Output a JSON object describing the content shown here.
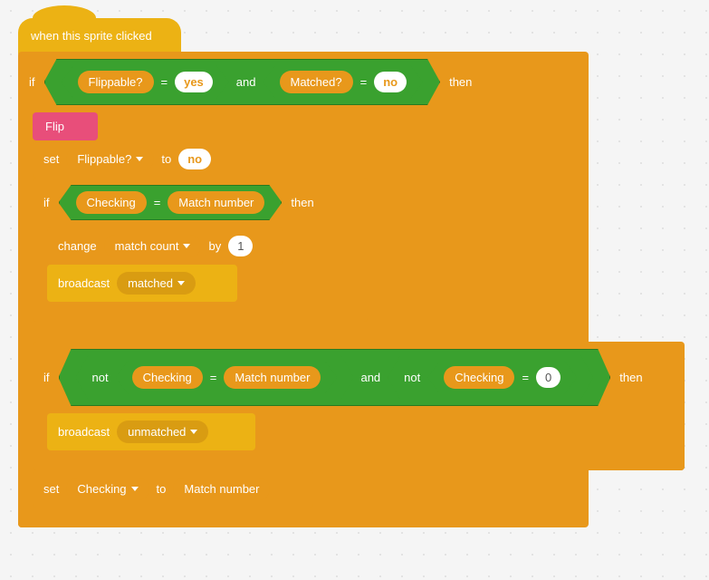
{
  "hat": {
    "label": "when this sprite clicked"
  },
  "if1": {
    "keyword_if": "if",
    "keyword_then": "then",
    "cond": {
      "left": {
        "var": "Flippable?",
        "eq": "=",
        "val": "yes"
      },
      "and": "and",
      "right": {
        "var": "Matched?",
        "eq": "=",
        "val": "no"
      }
    }
  },
  "flip": {
    "label": "Flip"
  },
  "set1": {
    "set": "set",
    "var": "Flippable?",
    "to": "to",
    "val": "no"
  },
  "if2": {
    "keyword_if": "if",
    "keyword_then": "then",
    "cond": {
      "left": "Checking",
      "eq": "=",
      "right": "Match number"
    }
  },
  "change": {
    "change": "change",
    "var": "match count",
    "by": "by",
    "val": "1"
  },
  "bc1": {
    "broadcast": "broadcast",
    "msg": "matched"
  },
  "if3": {
    "keyword_if": "if",
    "keyword_then": "then",
    "and": "and",
    "not": "not",
    "condL": {
      "left": "Checking",
      "eq": "=",
      "right": "Match number"
    },
    "condR": {
      "left": "Checking",
      "eq": "=",
      "right": "0"
    }
  },
  "bc2": {
    "broadcast": "broadcast",
    "msg": "unmatched"
  },
  "set2": {
    "set": "set",
    "var": "Checking",
    "to": "to",
    "val": "Match number"
  }
}
